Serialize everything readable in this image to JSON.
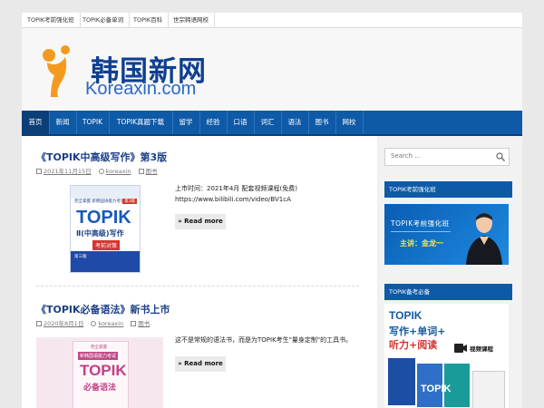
{
  "top_links": [
    "TOPIK考前强化班",
    "TOPIK必备单词",
    "TOPIK百科",
    "世宗韩语网校"
  ],
  "logo": {
    "cn": "韩国新网",
    "en": "Koreaxin.com"
  },
  "nav": [
    "首页",
    "新闻",
    "TOPIK",
    "TOPIK真题下载",
    "留学",
    "经验",
    "口语",
    "词汇",
    "语法",
    "图书",
    "网校"
  ],
  "posts": [
    {
      "title": "《TOPIK中高级写作》第3版",
      "date": "2021年11月15日",
      "author": "koreaxin",
      "category": "图书",
      "excerpt_line1": "上市时间：2021年4月 配套视频课程(免费)",
      "excerpt_line2": "https://www.bilibili.com/video/BV1cA",
      "more": "» Read more",
      "cover": {
        "top": "完全掌握 新韩国语能力考试",
        "topik": "TOPIK",
        "sub": "Ⅱ(中高级)写作",
        "tag": "考前对策",
        "badge": "第3版",
        "edition": "第三版"
      }
    },
    {
      "title": "《TOPIK必备语法》新书上市",
      "date": "2020年8月1日",
      "author": "koreaxin",
      "category": "图书",
      "excerpt_line1": "这不是常规的语法书，而是为TOPIK考生\"量身定制\"的工具书。",
      "more": "» Read more",
      "cover": {
        "top": "完全掌握",
        "sub1": "新韩国语能力考试",
        "topik": "TOPIK",
        "sub2": "必备语法"
      }
    }
  ],
  "sidebar": {
    "search_placeholder": "Search ...",
    "widget1_title": "TOPIK考前强化班",
    "promo1": {
      "title": "TOPIK考前强化班",
      "teacher": "主讲：金龙一"
    },
    "widget2_title": "TOPIK备考必备",
    "promo2": {
      "topik": "TOPIK",
      "line1": "写作+单词+",
      "line2": "听力+阅读",
      "badge": "视频课程",
      "book": "TOPIK"
    }
  },
  "colors": {
    "nav_blue": "#0f5aa6",
    "title_blue": "#1b3f86",
    "logo_orange": "#f39a1e"
  }
}
